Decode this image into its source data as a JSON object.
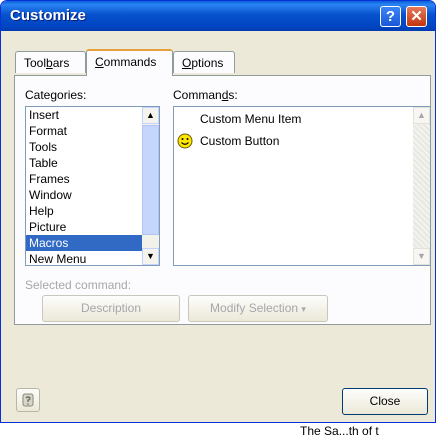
{
  "window": {
    "title": "Customize"
  },
  "titlebar": {
    "help_glyph": "?",
    "close_glyph": "✕"
  },
  "tabs": [
    {
      "label_pre": "Tool",
      "label_key": "b",
      "label_post": "ars"
    },
    {
      "label_pre": "",
      "label_key": "C",
      "label_post": "ommands"
    },
    {
      "label_pre": "",
      "label_key": "O",
      "label_post": "ptions"
    }
  ],
  "categories": {
    "label_pre": "Cate",
    "label_key": "g",
    "label_post": "ories:",
    "items": [
      "Insert",
      "Format",
      "Tools",
      "Table",
      "Frames",
      "Window",
      "Help",
      "Picture",
      "Macros",
      "New Menu"
    ],
    "selected": "Macros"
  },
  "commands": {
    "label_pre": "Comman",
    "label_key": "d",
    "label_post": "s:",
    "items": [
      {
        "label": "Custom Menu Item",
        "icon": "none"
      },
      {
        "label": "Custom Button",
        "icon": "smiley-icon"
      }
    ]
  },
  "selected_command": {
    "label": "Selected command:",
    "description_label": "Description",
    "modify_label": "Modify Selection",
    "modify_arrow": "▾"
  },
  "footer": {
    "close_label": "Close"
  },
  "background": {
    "fragment_bottom": "The Sa...th of t"
  },
  "colors": {
    "accent": "#316ac5",
    "titlebar": "#0852cd",
    "dialog_bg": "#ece9d8"
  }
}
